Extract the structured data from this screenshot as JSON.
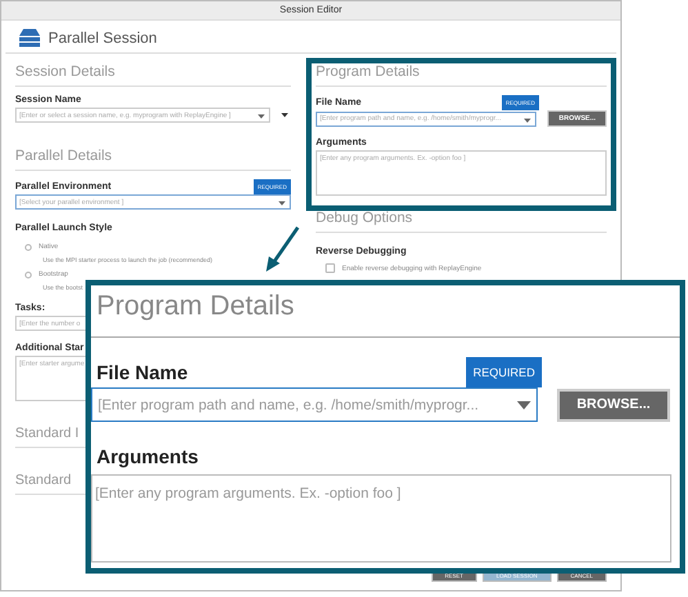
{
  "window": {
    "title": "Session Editor"
  },
  "header": {
    "title": "Parallel Session"
  },
  "session_details": {
    "heading": "Session Details",
    "session_name": {
      "label": "Session Name",
      "placeholder": "[Enter or select a session name,  e.g. myprogram with ReplayEngine ]"
    }
  },
  "parallel_details": {
    "heading": "Parallel Details",
    "environment": {
      "label": "Parallel Environment",
      "badge": "REQUIRED",
      "placeholder": "[Select your parallel environment ]"
    },
    "launch_style": {
      "label": "Parallel Launch Style",
      "options": [
        {
          "label": "Native",
          "description": "Use the MPI starter process to launch the job (recommended)",
          "selected": false
        },
        {
          "label": "Bootstrap",
          "description": "Use the bootst",
          "selected": false
        }
      ]
    },
    "tasks": {
      "label": "Tasks:",
      "placeholder": "[Enter the number o"
    },
    "starter": {
      "label": "Additional Star",
      "placeholder": "[Enter starter argume"
    }
  },
  "collapsed_sections": [
    "Standard I",
    "Standard"
  ],
  "program_details": {
    "heading": "Program Details",
    "file_name": {
      "label": "File Name",
      "badge": "REQUIRED",
      "placeholder": "[Enter program path and name, e.g. /home/smith/myprogr..."
    },
    "browse": "BROWSE...",
    "arguments": {
      "label": "Arguments",
      "placeholder": "[Enter any program arguments. Ex. -option foo ]"
    }
  },
  "debug_options": {
    "heading": "Debug Options",
    "reverse_debugging": {
      "label": "Reverse Debugging",
      "option": "Enable reverse debugging with ReplayEngine",
      "checked": false
    }
  },
  "buttons": [
    {
      "label": "RESET",
      "kind": "secondary"
    },
    {
      "label": "LOAD SESSION",
      "kind": "primary"
    },
    {
      "label": "CANCEL",
      "kind": "secondary"
    }
  ],
  "callout": {
    "heading": "Program Details",
    "file_name": {
      "label": "File Name",
      "badge": "REQUIRED",
      "placeholder": "[Enter program path and name, e.g. /home/smith/myprogr..."
    },
    "browse": "BROWSE...",
    "arguments": {
      "label": "Arguments",
      "placeholder": "[Enter any program arguments. Ex. -option foo ]"
    }
  }
}
